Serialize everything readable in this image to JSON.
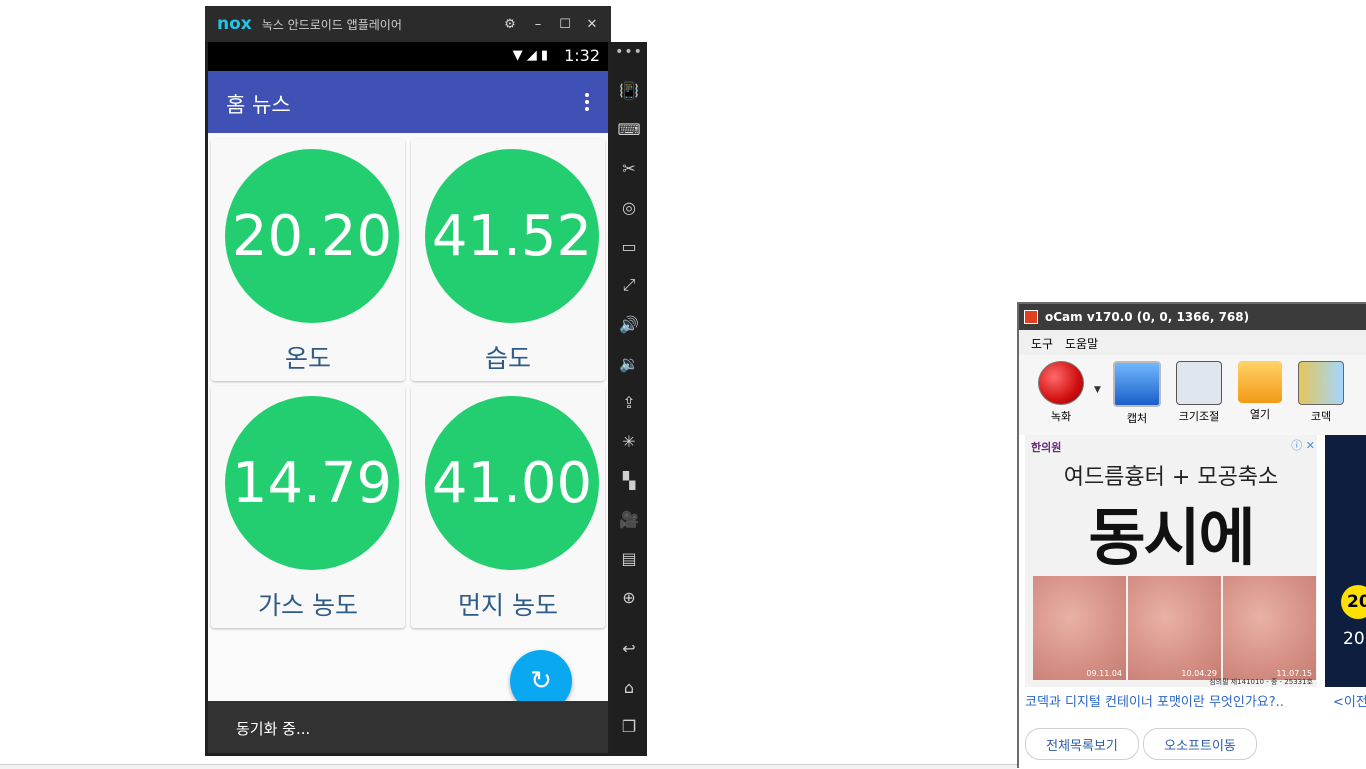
{
  "nox": {
    "logo": "nox",
    "title": "녹스 안드로이드 앱플레이어",
    "controls": {
      "settings": "⚙",
      "minimize": "–",
      "maximize": "☐",
      "close": "✕"
    }
  },
  "status_bar": {
    "time": "1:32",
    "icons": "▼ ◢ ▮"
  },
  "app": {
    "title": "홈 뉴스",
    "sensors": [
      {
        "value": "20.20",
        "label": "온도"
      },
      {
        "value": "41.52",
        "label": "습도"
      },
      {
        "value": "14.79",
        "label": "가스 농도"
      },
      {
        "value": "41.00",
        "label": "먼지 농도"
      }
    ],
    "fab_icon": "↻",
    "snackbar": "동기화 중..."
  },
  "sidebar": {
    "dots": "•••",
    "icons": [
      "📳",
      "⌨",
      "✂",
      "◎",
      "▭",
      "⤢",
      "🔊",
      "🔉",
      "⇪",
      "✳",
      "▚",
      "🎥",
      "▤",
      "⊕",
      "↩",
      "⌂",
      "❐"
    ]
  },
  "ocam": {
    "title": "oCam v170.0 (0, 0, 1366, 768)",
    "menu": [
      "도구",
      "도움말"
    ],
    "tools": [
      "녹화",
      "캡처",
      "크기조절",
      "열기",
      "코덱"
    ],
    "ad": {
      "logo": "한의원",
      "subtitle": "여드름흉터 + 모공축소",
      "headline": "동시에",
      "dates": [
        "09.11.04",
        "10.04.29",
        "11.07.15"
      ],
      "footer": "심의필 제141010 - 중 - 25331호",
      "close": "ⓘ ✕",
      "right_badge": "20",
      "right_num": "20"
    },
    "link": "코덱과 디지털 컨테이너 포맷이란 무엇인가요?..",
    "link2": "<이전",
    "buttons": [
      "전체목록보기",
      "오소프트이동"
    ]
  },
  "colors": {
    "accent": "#3f51b5",
    "circle": "#23ce70",
    "fab": "#09a8f1",
    "label": "#2e5a87"
  }
}
